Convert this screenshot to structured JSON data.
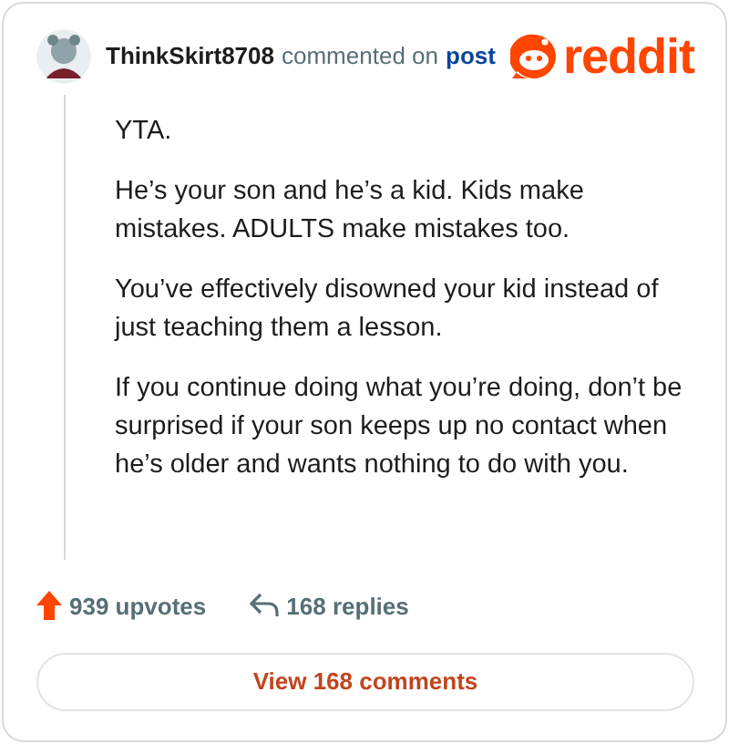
{
  "comment": {
    "author": "ThinkSkirt8708",
    "action": "commented on",
    "link": "post",
    "logo_text": "reddit",
    "paragraphs": [
      "YTA.",
      "He’s your son and he’s a kid. Kids make mistakes. ADULTS make mistakes too.",
      "You’ve effectively disowned your kid instead of just teaching them a lesson.",
      "If you continue doing what you’re doing, don’t be surprised if your son keeps up no contact when he’s older and wants nothing to do with you."
    ],
    "upvotes": "939 upvotes",
    "replies": "168 replies"
  },
  "button": "View 168 comments"
}
